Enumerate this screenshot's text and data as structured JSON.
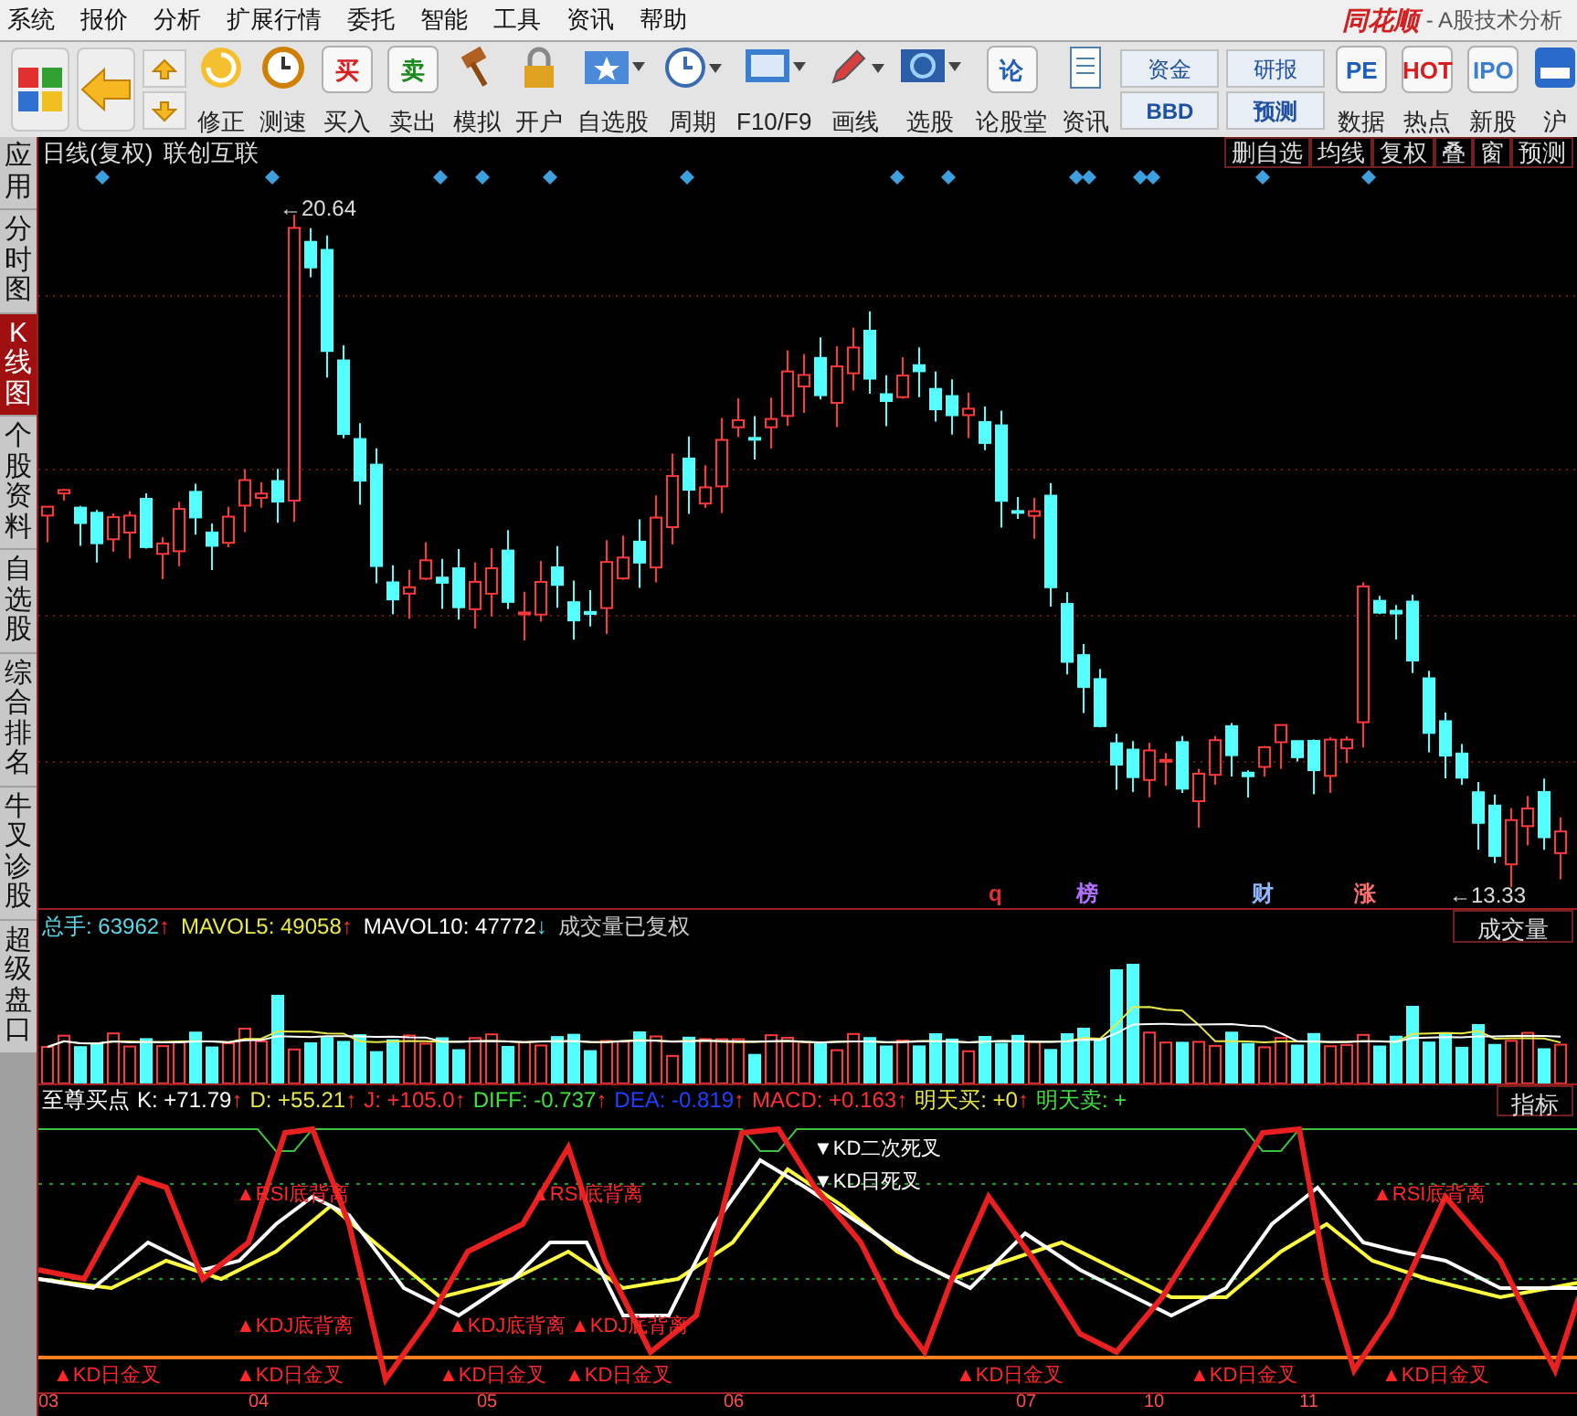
{
  "menu": [
    "系统",
    "报价",
    "分析",
    "扩展行情",
    "委托",
    "智能",
    "工具",
    "资讯",
    "帮助"
  ],
  "app": {
    "logo": "同花顺",
    "title": "- A股技术分析"
  },
  "toolbar": [
    {
      "kind": "icon"
    },
    {
      "kind": "icon"
    },
    {
      "kind": "arrows"
    },
    {
      "kind": "button",
      "label": "修正"
    },
    {
      "kind": "button",
      "label": "测速"
    },
    {
      "kind": "glyph",
      "glyph": "买",
      "label": "买入",
      "color": "#d81e1e"
    },
    {
      "kind": "glyph",
      "glyph": "卖",
      "label": "卖出",
      "color": "#1a8a1a"
    },
    {
      "kind": "button",
      "label": "模拟"
    },
    {
      "kind": "button",
      "label": "开户"
    },
    {
      "kind": "dropdown",
      "label": "自选股"
    },
    {
      "kind": "dropdown",
      "label": "周期"
    },
    {
      "kind": "dropdown",
      "label": "F10/F9"
    },
    {
      "kind": "dropdown",
      "label": "画线"
    },
    {
      "kind": "dropdown",
      "label": "选股"
    },
    {
      "kind": "glyph",
      "glyph": "论",
      "label": "论股堂",
      "color": "#1f5fb8"
    },
    {
      "kind": "button",
      "label": "资讯"
    },
    {
      "kind": "pair",
      "labels": [
        "资金",
        "BBD"
      ]
    },
    {
      "kind": "pair",
      "labels": [
        "研报",
        "预测"
      ]
    },
    {
      "kind": "glyph",
      "glyph": "PE",
      "label": "数据",
      "color": "#1f5fb8"
    },
    {
      "kind": "glyph",
      "glyph": "HOT",
      "label": "热点",
      "color": "#d81e1e"
    },
    {
      "kind": "glyph",
      "glyph": "IPO",
      "label": "新股",
      "color": "#3a7fd0"
    },
    {
      "kind": "button",
      "label": "沪"
    }
  ],
  "sidebar": [
    {
      "label": "应用",
      "selected": false
    },
    {
      "label": "分时图",
      "selected": false
    },
    {
      "label": "K线图",
      "selected": true
    },
    {
      "label": "个股资料",
      "selected": false
    },
    {
      "label": "自选股",
      "selected": false
    },
    {
      "label": "综合排名",
      "selected": false
    },
    {
      "label": "牛叉诊股",
      "selected": false
    },
    {
      "label": "超级盘口",
      "selected": false
    }
  ],
  "chart": {
    "title": "日线(复权)",
    "stock": "联创互联",
    "buttons": [
      "删自选",
      "均线",
      "复权",
      "叠",
      "窗",
      "预测"
    ],
    "high_label": "←20.64",
    "low_label": "←13.33",
    "events": [
      {
        "label": "q",
        "color": "#e03030"
      },
      {
        "label": "榜",
        "color": "#b070ff"
      },
      {
        "label": "财",
        "color": "#8fb8ff"
      },
      {
        "label": "涨",
        "color": "#ff7070"
      }
    ]
  },
  "volume": {
    "legend": [
      {
        "text": "总手: 63962",
        "color": "#5bd7e8",
        "arrow": "↑",
        "rising": true
      },
      {
        "text": "MAVOL5: 49058",
        "color": "#e8e84a",
        "arrow": "↑",
        "rising": true
      },
      {
        "text": "MAVOL10: 47772",
        "color": "#ffffff",
        "arrow": "↓",
        "rising": false
      }
    ],
    "note": "成交量已复权",
    "button": "成交量"
  },
  "indicator": {
    "name": "至尊买点",
    "legend": [
      {
        "text": "K: +71.79",
        "color": "#ffffff",
        "arrow": "↑"
      },
      {
        "text": "D: +55.21",
        "color": "#e8e84a",
        "arrow": "↑"
      },
      {
        "text": "J: +105.0",
        "color": "#ff3030",
        "arrow": "↑"
      },
      {
        "text": "DIFF: -0.737",
        "color": "#40e040",
        "arrow": "↑"
      },
      {
        "text": "DEA: -0.819",
        "color": "#2040ff",
        "arrow": "↑"
      },
      {
        "text": "MACD: +0.163",
        "color": "#ff3030",
        "arrow": "↑"
      },
      {
        "text": "明天买: +0",
        "color": "#e8e84a",
        "arrow": "↑"
      },
      {
        "text": "明天卖: +",
        "color": "#40e040"
      }
    ],
    "button": "指标",
    "signals": [
      {
        "text": "▲RSI底背离",
        "kind": "buy"
      },
      {
        "text": "▲RSI底背离",
        "kind": "buy"
      },
      {
        "text": "▲RSI底背离",
        "kind": "buy"
      },
      {
        "text": "▼KD二次死叉",
        "kind": "sell"
      },
      {
        "text": "▼KD日死叉",
        "kind": "sell"
      },
      {
        "text": "▲KDJ底背离",
        "kind": "buy"
      },
      {
        "text": "▲KDJ底背离",
        "kind": "buy"
      },
      {
        "text": "▲KDJ底背离",
        "kind": "buy"
      },
      {
        "text": "▲KD日金叉",
        "kind": "buy"
      },
      {
        "text": "▲KD日金叉",
        "kind": "buy"
      },
      {
        "text": "▲KD日金叉",
        "kind": "buy"
      },
      {
        "text": "▲KD日金叉",
        "kind": "buy"
      },
      {
        "text": "▲KD日金叉",
        "kind": "buy"
      },
      {
        "text": "▲KD日金叉",
        "kind": "buy"
      },
      {
        "text": "▲KD日金叉",
        "kind": "buy"
      }
    ]
  },
  "dates": [
    "03",
    "04",
    "05",
    "06",
    "07",
    "10",
    "11"
  ]
}
